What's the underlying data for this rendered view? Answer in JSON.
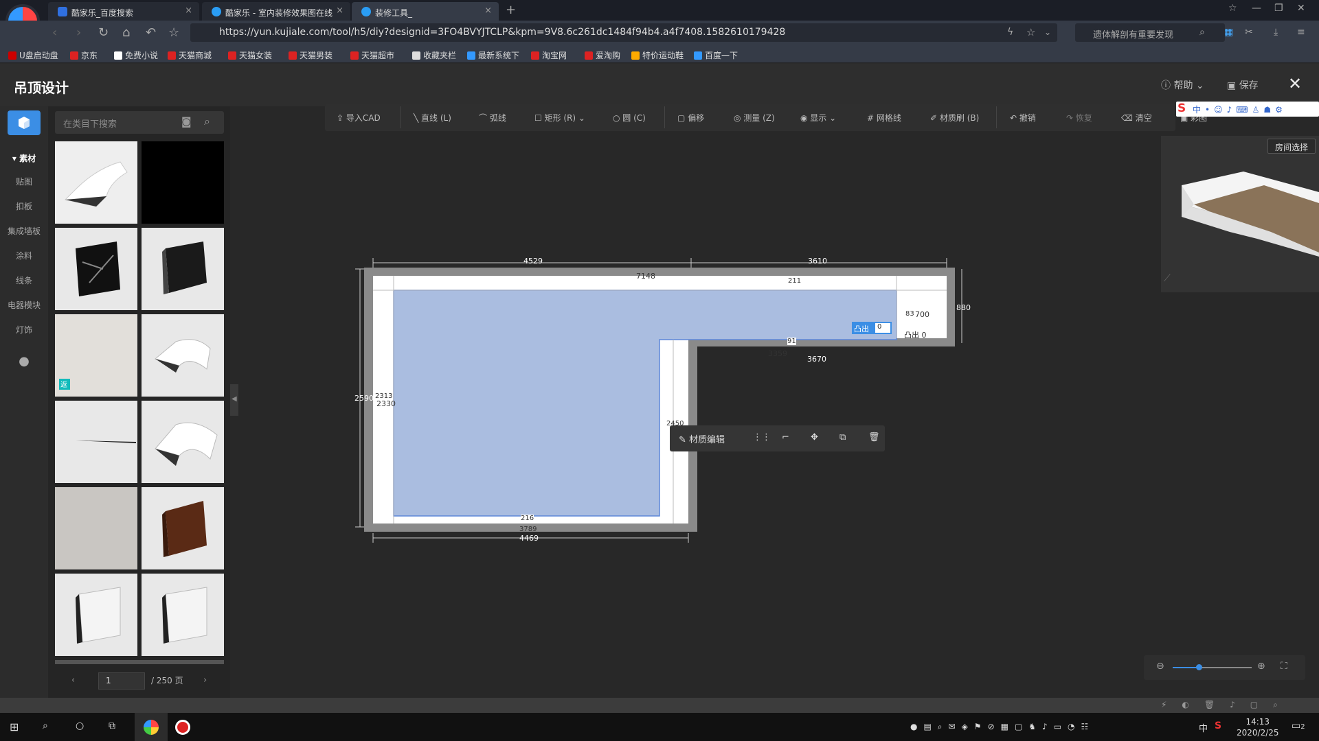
{
  "browser": {
    "tabs": [
      {
        "label": "酷家乐_百度搜索",
        "active": false
      },
      {
        "label": "酷家乐 - 室内装修效果图在线",
        "active": false
      },
      {
        "label": "装修工具_",
        "active": true
      }
    ],
    "url": "https://yun.kujiale.com/tool/h5/diy?designid=3FO4BVYJTCLP&kpm=9V8.6c261dc1484f94b4.a4f7408.1582610179428",
    "search_placeholder": "遗体解剖有重要发现",
    "bookmarks": [
      "U盘启动盘",
      "京东",
      "免费小说",
      "天猫商城",
      "天猫女装",
      "天猫男装",
      "天猫超市",
      "收藏夹栏",
      "最新系统下",
      "淘宝网",
      "爱淘购",
      "特价运动鞋",
      "百度一下"
    ]
  },
  "app": {
    "title": "吊顶设计",
    "help": "帮助",
    "save": "保存"
  },
  "leftnav": {
    "section": "素材",
    "items": [
      "贴图",
      "扣板",
      "集成墙板",
      "涂料",
      "线条",
      "电器模块",
      "灯饰"
    ]
  },
  "materials": {
    "search_placeholder": "在类目下搜索",
    "page": "1",
    "total_pages": "/ 250 页",
    "badge": "返"
  },
  "toolbar": {
    "import_cad": "导入CAD",
    "line": "直线 (L)",
    "arc": "弧线",
    "rect": "矩形 (R)",
    "circle": "圆 (C)",
    "offset": "偏移",
    "measure": "测量 (Z)",
    "display": "显示",
    "grid": "网格线",
    "material_brush": "材质刷 (B)",
    "undo": "撤销",
    "redo": "恢复",
    "clear": "清空",
    "extra": "彩图"
  },
  "preview": {
    "room_select": "房间选择"
  },
  "context_bar": {
    "material_edit": "材质编辑"
  },
  "plan": {
    "dims": {
      "top_left": "4529",
      "top_right": "3610",
      "inner_top": "7148",
      "wall_211": "211",
      "right_side": "880",
      "r700": "700",
      "r_small": "83",
      "mid_91": "91",
      "mid_3359": "3359",
      "mid_3670": "3670",
      "left_side": "2590",
      "left_inner": "2330",
      "left_inner2": "2313",
      "bottom": "4469",
      "bottom_small": "3789",
      "bottom_inner": "216",
      "vert_mid": "2450"
    },
    "extrude_label": "凸出",
    "extrude_value": "0",
    "extrude_label2": "凸出",
    "extrude_value2": "0"
  },
  "taskbar": {
    "time": "14:13",
    "date": "2020/2/25",
    "ime": "中",
    "notif": "2"
  },
  "colors": {
    "accent": "#3b8ee5",
    "ceiling_fill": "#aabde0",
    "canvas_bg": "#282828"
  }
}
